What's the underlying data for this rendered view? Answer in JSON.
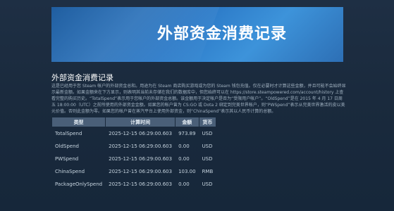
{
  "banner": {
    "title": "外部资金消费记录"
  },
  "section": {
    "title": "外部资金消费记录",
    "description": "这是已经用于您 Steam 帐户的外部资金总和。用途为在 Steam 商店购买游戏或为您的 Steam 钱包充值。仅在必要时才计算这些金额，并且可能不会始终显示最新金额。如果金额来在下方显示，则表明其当前未存储在我们的数据库中，但您始终可以在 https://store.steampowered.com/account/history 上查看完整的购买历史。“TotalSpend”表示用于您帐户的外部资金总额。该金额用于决定帐户是否为“受限用户帐户”。“OldSpend”是在 2015 年 4 月 17 日周五 18:00:00（UTC）之前所使用的外部资金金额。如果您的帐户曾为 CS:GO 或 Dota 2 绑定到完美世界帐户，则“PWSpend”表示从完美世界激活的皮以美元价值。否则此金额为零。如果您的帐户曾在蒸汽平台上使用外部资金，则“ChinaSpend”表示其以人民币计算的总额。"
  },
  "table": {
    "headers": [
      "类型",
      "计算时间",
      "金额",
      "货币"
    ],
    "rows": [
      {
        "type": "TotalSpend",
        "time": "2025-12-15 06:29:00.603",
        "amount": "973.89",
        "currency": "USD"
      },
      {
        "type": "OldSpend",
        "time": "2025-12-15 06:29:00.603",
        "amount": "0.00",
        "currency": "USD"
      },
      {
        "type": "PWSpend",
        "time": "2025-12-15 06:29:00.603",
        "amount": "0.00",
        "currency": "USD"
      },
      {
        "type": "ChinaSpend",
        "time": "2025-12-15 06:29:00.603",
        "amount": "103.00",
        "currency": "RMB"
      },
      {
        "type": "PackageOnlySpend",
        "time": "2025-12-15 06:29:00.603",
        "amount": "0.00",
        "currency": "USD"
      }
    ]
  }
}
